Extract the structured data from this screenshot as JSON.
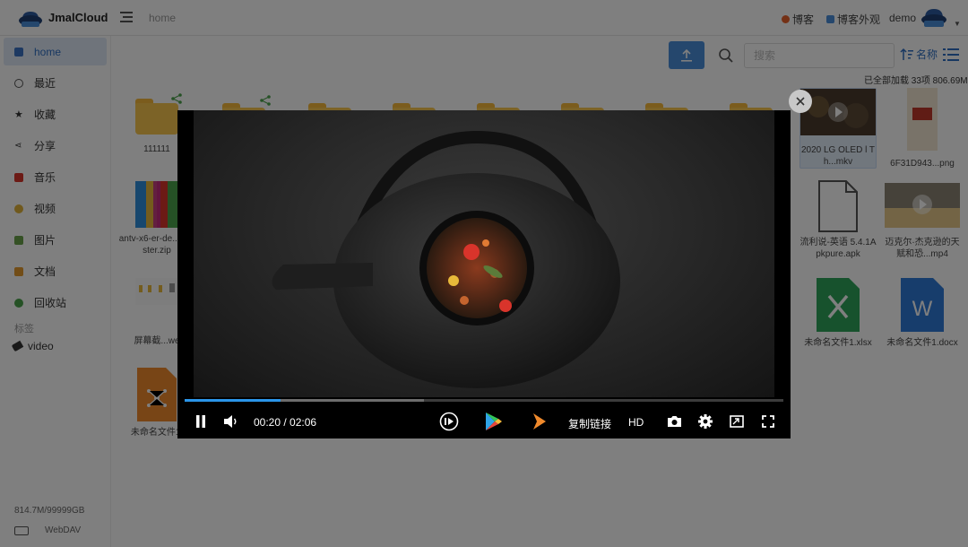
{
  "app": {
    "title": "JmalCloud",
    "path": "home"
  },
  "header": {
    "links": [
      {
        "label": "博客",
        "color": "#e8622c"
      },
      {
        "label": "博客外观",
        "color": "#4a8fdb"
      }
    ],
    "user": "demo"
  },
  "sidebar": {
    "items": [
      {
        "label": "home",
        "icon": "folder-icon",
        "color": "#3a72c4"
      },
      {
        "label": "最近",
        "icon": "clock-icon",
        "color": "#555555"
      },
      {
        "label": "收藏",
        "icon": "star-icon",
        "color": "#333333"
      },
      {
        "label": "分享",
        "icon": "share-icon",
        "color": "#333333"
      },
      {
        "label": "音乐",
        "icon": "music-icon",
        "color": "#d9342b"
      },
      {
        "label": "视频",
        "icon": "video-icon",
        "color": "#e0b23a"
      },
      {
        "label": "图片",
        "icon": "image-icon",
        "color": "#6ba34a"
      },
      {
        "label": "文档",
        "icon": "document-icon",
        "color": "#e59a2f"
      },
      {
        "label": "回收站",
        "icon": "trash-icon",
        "color": "#4aa34a"
      }
    ],
    "tags_heading": "标签",
    "tags": [
      {
        "label": "video"
      }
    ],
    "storage": "814.7M/99999GB",
    "webdav": "WebDAV"
  },
  "toolbar": {
    "search_placeholder": "搜索",
    "sort_label": "名称",
    "load_status": "已全部加载 33项 806.69M"
  },
  "files": [
    {
      "name": "111111",
      "type": "folder",
      "shared": true
    },
    {
      "name": "antv-x6-er-de... master.zip",
      "type": "archive"
    },
    {
      "name": "屏幕截...we",
      "type": "image"
    },
    {
      "name": "未命名文件1.",
      "type": "mindmap"
    },
    {
      "name": "2020 LG OLED l Th...mkv",
      "type": "video"
    },
    {
      "name": "6F31D943...png",
      "type": "image"
    },
    {
      "name": "流利说-英语 5.4.1Apkpure.apk",
      "type": "file"
    },
    {
      "name": "迈克尔·杰克逊的天 赋和恐...mp4",
      "type": "video"
    },
    {
      "name": "未命名文件1.xlsx",
      "type": "excel"
    },
    {
      "name": "未命名文件1.docx",
      "type": "word"
    }
  ],
  "player": {
    "time": "00:20 / 02:06",
    "progress": 0.16,
    "buffered": 0.4,
    "copy_link_label": "复制链接",
    "quality": "HD"
  }
}
